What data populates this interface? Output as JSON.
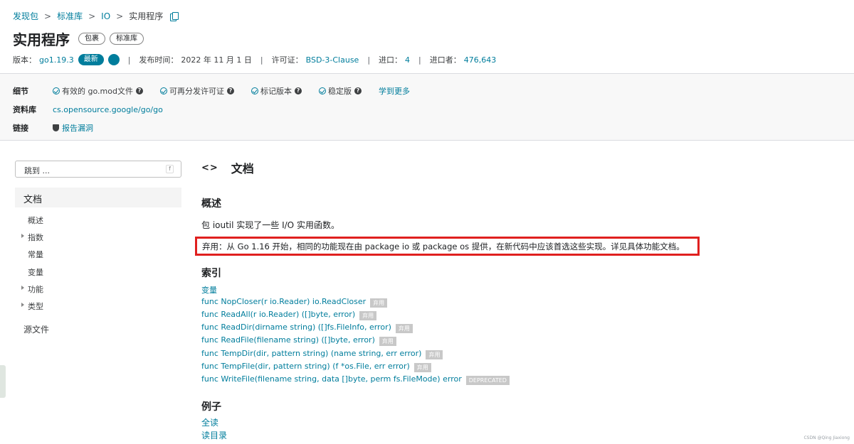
{
  "breadcrumb": {
    "items": [
      "发现包",
      "标准库",
      "IO"
    ],
    "current": "实用程序"
  },
  "header": {
    "title": "实用程序",
    "chips": [
      "包裹",
      "标准库"
    ],
    "version_label": "版本：",
    "version": "go1.19.3",
    "latest_badge": "最新",
    "published_label": "发布时间：",
    "published": "2022 年 11 月 1 日",
    "license_label": "许可证：",
    "license": "BSD-3-Clause",
    "imports_label": "进口：",
    "imports": "4",
    "importers_label": "进口者：",
    "importers": "476,643"
  },
  "details": {
    "details_label": "细节",
    "items": [
      "有效的 go.mod文件",
      "可再分发许可证",
      "标记版本",
      "稳定版"
    ],
    "learn_more": "学到更多",
    "repo_label": "资料库",
    "repo": "cs.opensource.google/go/go",
    "links_label": "链接",
    "report": "报告漏洞"
  },
  "sidebar": {
    "search_placeholder": "跳到 ...",
    "search_key": "f",
    "active": "文档",
    "items": [
      "概述",
      "指数",
      "常量",
      "变量",
      "功能",
      "类型"
    ],
    "source": "源文件"
  },
  "main": {
    "code_glyph": "<>",
    "title": "文档",
    "overview_title": "概述",
    "overview_text": "包 ioutil 实现了一些 I/O 实用函数。",
    "deprecated_text": "弃用：从 Go 1.16 开始，相同的功能现在由 package io 或 package os 提供，在新代码中应该首选这些实现。详见具体功能文档。",
    "index_title": "索引",
    "index_variables": "变量",
    "funcs": [
      {
        "sig": "func NopCloser(r io.Reader) io.ReadCloser",
        "tag": "弃用"
      },
      {
        "sig": "func ReadAll(r io.Reader) ([]byte, error)",
        "tag": "弃用"
      },
      {
        "sig": "func ReadDir(dirname string) ([]fs.FileInfo, error)",
        "tag": "弃用"
      },
      {
        "sig": "func ReadFile(filename string) ([]byte, error)",
        "tag": "弃用"
      },
      {
        "sig": "func TempDir(dir, pattern string) (name string, err error)",
        "tag": "弃用"
      },
      {
        "sig": "func TempFile(dir, pattern string) (f *os.File, err error)",
        "tag": "弃用"
      },
      {
        "sig": "func WriteFile(filename string, data []byte, perm fs.FileMode) error",
        "tag": "DEPRECATED"
      }
    ],
    "examples_title": "例子",
    "examples": [
      "全读",
      "读目录"
    ]
  },
  "watermark": "CSDN @Qing Jiaxiong"
}
